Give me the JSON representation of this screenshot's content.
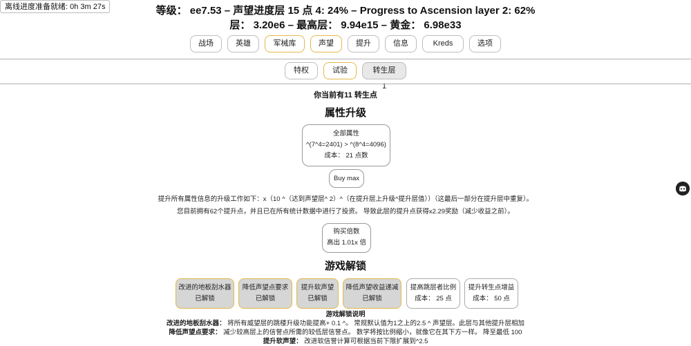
{
  "offline": "离线进度准备就绪:   0h 3m 27s",
  "stats": {
    "line1": "等级： ee7.53 – 声望进度层 15 点 4: 24% – Progress to Ascension layer 2: 62%",
    "line2": "层： 3.20e6 – 最高层： 9.94e15 – 黄金： 6.98e33"
  },
  "main_tabs": [
    "战场",
    "英雄",
    "军械库",
    "声望",
    "提升",
    "信息",
    "Kreds",
    "选项"
  ],
  "sub_tabs": [
    "特权",
    "试验",
    "转生层 1"
  ],
  "points_text": "你当前有11 转生点",
  "attr_title": "属性升级",
  "attr_box": {
    "title": "全部属性",
    "formula": "^(7^4=2401) > ^(8^4=4096)",
    "cost": "成本： 21 点数"
  },
  "buy_max": "Buy max",
  "desc1": "提升所有属性信息的升级工作如下：x（10 ^（达到声望层^ 2）^（在提升层上升级^提升层值））（这最后一部分在提升层中重复）。",
  "desc2": "您目前拥有62个提升点，并且已在所有统计数据中进行了投资。 导致此层的提升点获得x2.29奖励（减少收益之前）。",
  "buy_multi": {
    "title": "购买倍数",
    "value": "高出 1.01x 倍"
  },
  "unlock_title": "游戏解锁",
  "unlocks": [
    {
      "title": "改进的地板刮水器",
      "status": "已解锁"
    },
    {
      "title": "降低声望点要求",
      "status": "已解锁"
    },
    {
      "title": "提升软声望",
      "status": "已解锁"
    },
    {
      "title": "降低声望收益递减",
      "status": "已解锁"
    },
    {
      "title": "提高跳层者比例",
      "status": "成本： 25 点"
    },
    {
      "title": "提升转生点增益",
      "status": "成本： 50 点"
    }
  ],
  "explain_title": "游戏解锁说明",
  "explain": [
    {
      "name": "改进的地板刮水器：",
      "text": " 将所有威望层的跳楼升级功能提高+ 0.1 ^。 常规默认值为1之上的2.5 ^ 声望层。此层与其他提升层相加"
    },
    {
      "name": "降低声望点要求：",
      "text": " 减少较高层上的信誉点所需的较低层信誉点。 数学将按比例缩小，就像它在其下方一样。 降至最低 100"
    },
    {
      "name": "提升软声望：",
      "text": " 改进软信誉计算可根据当前下限扩展到^2.5"
    }
  ],
  "colors": {
    "accent": "#e3b84a",
    "pressed": "#d6d6d6",
    "border": "#999999"
  },
  "icons": {
    "chat": "discord-icon"
  }
}
